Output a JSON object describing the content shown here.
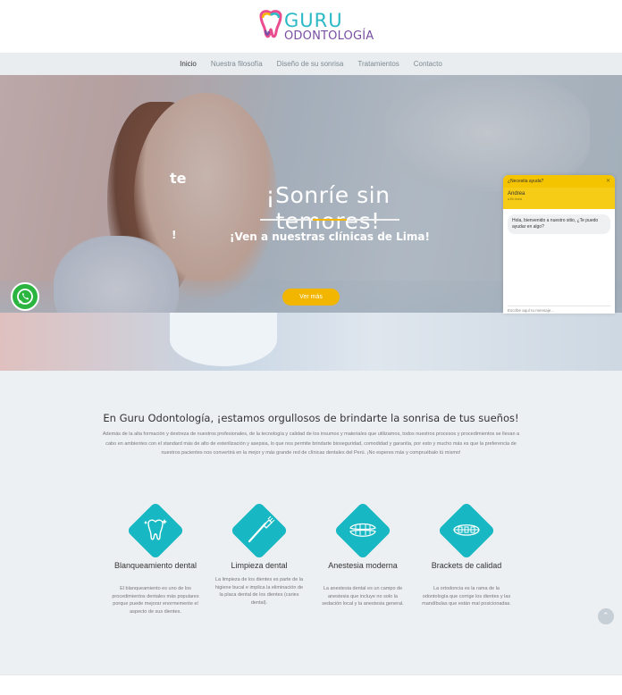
{
  "brand": {
    "line1": "GURU",
    "line2": "ODONTOLOGÍA"
  },
  "nav": {
    "items": [
      {
        "label": "Inicio"
      },
      {
        "label": "Nuestra filosofía"
      },
      {
        "label": "Diseño de su sonrisa"
      },
      {
        "label": "Tratamientos"
      },
      {
        "label": "Contacto"
      }
    ]
  },
  "hero": {
    "title": "¡Sonríe sin temores!",
    "subtitle": "¡Ven a nuestras clínicas de Lima!",
    "fragment_top": "te",
    "fragment_bottom": "!",
    "button_label": "Ver más"
  },
  "chat": {
    "header": "¿Necesita ayuda?",
    "close": "✕",
    "agent_name": "Andrea",
    "agent_status": "● En línea",
    "message": "Hola, bienvenido a nuestro sitio, ¿Te puedo ayudar en algo?",
    "input_placeholder": "Escribe aquí tu mensaje..."
  },
  "about": {
    "title": "En Guru Odontología, ¡estamos orgullosos de brindarte la sonrisa de tus sueños!",
    "text": "Además de la alta formación y destreza de nuestros profesionales, de la tecnología y calidad de los insumos y materiales que utilizamos, todos nuestros procesos y procedimientos se llevan a cabo en ambientes con el standard más de alto de esterilización y asepsia, lo que nos permite brindarte bioseguridad, comodidad y garantía, por esto y mucho más es que la preferencia de nuestros pacientes nos convertirá en la mejor y más grande red de clínicas dentales del Perú. ¡No esperes más y compruébalo tú mismo!"
  },
  "services": [
    {
      "title": "Blanqueamiento dental",
      "description": "El blanqueamiento es uno de los procedimientos dentales más populares porque puede mejorar enormemente el aspecto de sus dientes.",
      "icon": "sparkling-tooth-icon"
    },
    {
      "title": "Limpieza dental",
      "description": "La limpieza de los dientes es parte de la higiene bucal e implica la eliminación de la placa dental de los dientes (caries dental).",
      "icon": "toothbrush-icon"
    },
    {
      "title": "Anestesia moderna",
      "description": "La anestesia dental es un campo de anestesia que incluye no solo la sedación local y la anestesia general.",
      "icon": "dentures-icon"
    },
    {
      "title": "Brackets de calidad",
      "description": "La ortodoncia es la rama de la odontología que corrige los dientes y las mandíbulas que están mal posicionadas.",
      "icon": "braces-icon"
    }
  ],
  "colors": {
    "accent": "#17b8c3",
    "button": "#f2b600",
    "whatsapp": "#2ab540"
  },
  "scroll_top": "⌃"
}
